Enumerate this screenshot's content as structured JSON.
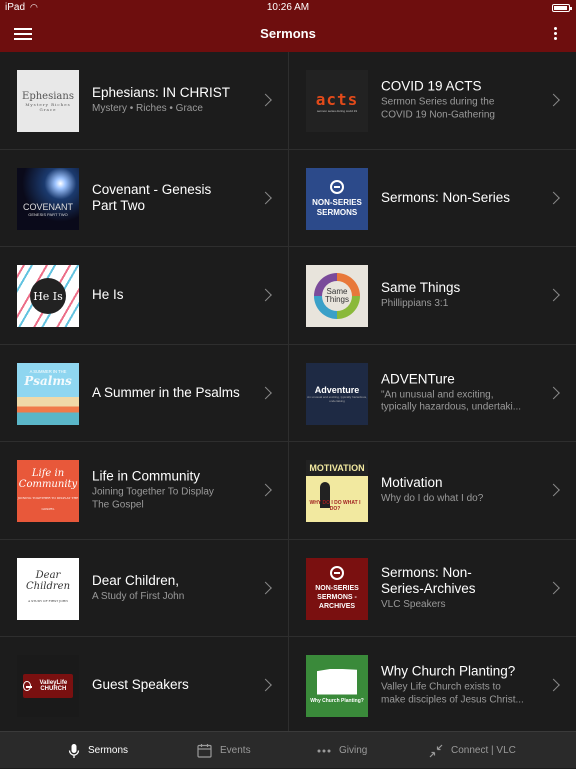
{
  "status": {
    "carrier": "iPad",
    "time": "10:26 AM"
  },
  "nav": {
    "title": "Sermons"
  },
  "items": [
    {
      "title": "Ephesians: IN CHRIST",
      "subtitle": "Mystery • Riches • Grace",
      "thumb_text": "Ephesians",
      "thumb_sub": "Mystery Riches Grace"
    },
    {
      "title": "COVID 19 ACTS",
      "subtitle": "Sermon Series during the\nCOVID 19 Non-Gathering",
      "thumb_text": "acts",
      "thumb_sub": "sermon series during covid 19"
    },
    {
      "title": "Covenant - Genesis\nPart Two",
      "subtitle": "",
      "thumb_text": "COVENANT",
      "thumb_sub": "GENESIS PART TWO"
    },
    {
      "title": "Sermons: Non-Series",
      "subtitle": "",
      "thumb_text": "NON-SERIES SERMONS",
      "thumb_sub": ""
    },
    {
      "title": "He Is",
      "subtitle": "",
      "thumb_text": "He Is",
      "thumb_sub": ""
    },
    {
      "title": "Same Things",
      "subtitle": "Phillippians 3:1",
      "thumb_text": "Same Things",
      "thumb_sub": ""
    },
    {
      "title": "A Summer in the Psalms",
      "subtitle": "",
      "thumb_text": "Psalms",
      "thumb_sub": "A SUMMER IN THE"
    },
    {
      "title": "ADVENTure",
      "subtitle": "\"An unusual and exciting,\ntypically hazardous, undertaki...",
      "thumb_text": "Adventure",
      "thumb_sub": "An unusual and exciting, typically hazardous, undertaking"
    },
    {
      "title": "Life in Community",
      "subtitle": "Joining Together To Display\nThe Gospel",
      "thumb_text": "Life in Community",
      "thumb_sub": "JOINING TOGETHER TO DISPLAY THE GOSPEL"
    },
    {
      "title": "Motivation",
      "subtitle": "Why do I do what I do?",
      "thumb_text": "MOTIVATION",
      "thumb_sub": "WHY DO I DO WHAT I DO?"
    },
    {
      "title": "Dear Children,",
      "subtitle": "A Study of First John",
      "thumb_text": "Dear Children",
      "thumb_sub": "A STUDY OF FIRST JOHN"
    },
    {
      "title": "Sermons: Non-\nSeries-Archives",
      "subtitle": "VLC Speakers",
      "thumb_text": "NON-SERIES SERMONS - ARCHIVES",
      "thumb_sub": ""
    },
    {
      "title": "Guest Speakers",
      "subtitle": "",
      "thumb_text": "ValleyLife CHURCH",
      "thumb_sub": ""
    },
    {
      "title": "Why Church Planting?",
      "subtitle": "Valley Life Church exists to\nmake disciples of Jesus Christ...",
      "thumb_text": "Why Church Planting?",
      "thumb_sub": ""
    }
  ],
  "tabs": [
    {
      "label": "Sermons",
      "icon": "microphone-icon"
    },
    {
      "label": "Events",
      "icon": "calendar-icon"
    },
    {
      "label": "Giving",
      "icon": "dots-icon"
    },
    {
      "label": "Connect | VLC",
      "icon": "compress-icon"
    }
  ],
  "colors": {
    "header": "#6e0e0e",
    "background": "#1c1c1c",
    "tab_bar": "#2a2a2a"
  }
}
